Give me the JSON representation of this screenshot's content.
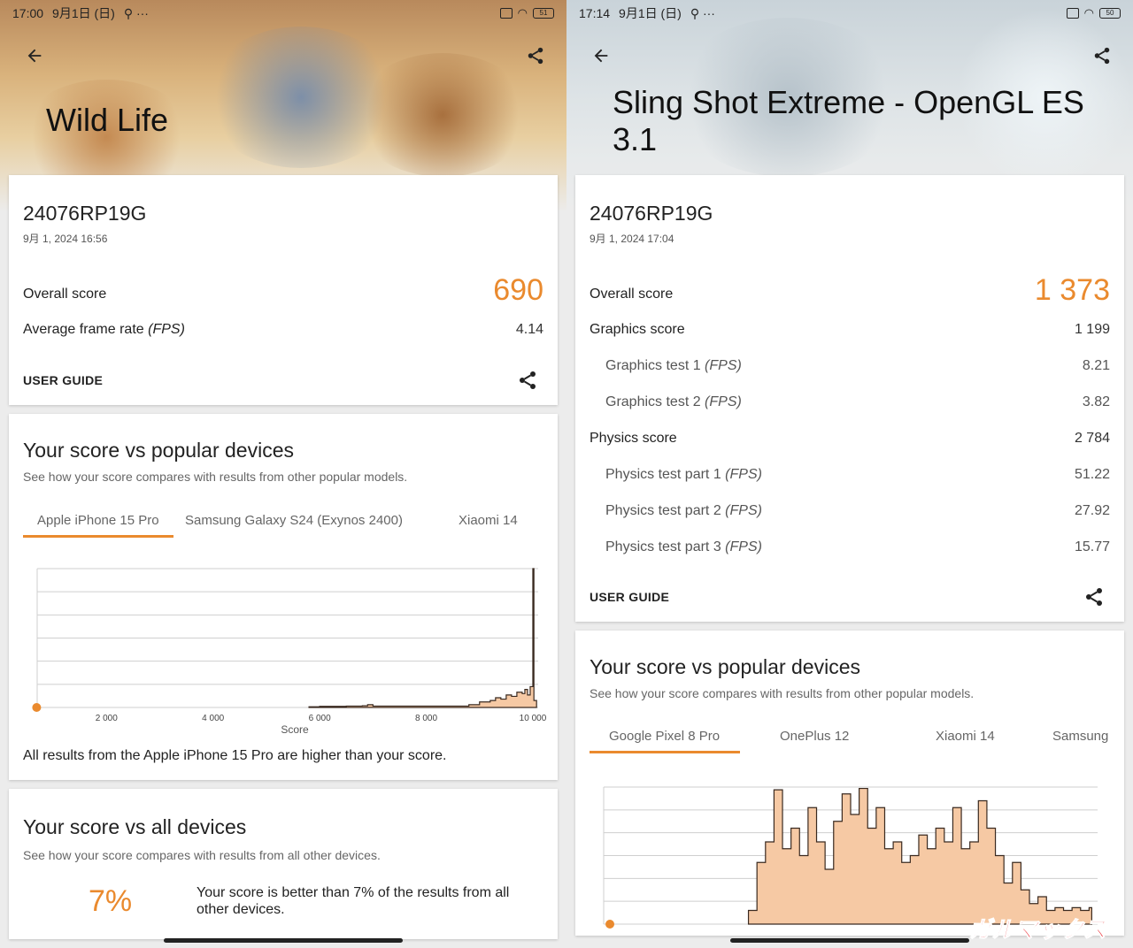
{
  "left": {
    "status": {
      "time": "17:00",
      "date": "9月1日 (日)",
      "battery": "51"
    },
    "title": "Wild Life",
    "device": "24076RP19G",
    "date": "9月 1, 2024 16:56",
    "overall_label": "Overall score",
    "overall_value": "690",
    "fps_label": "Average frame rate",
    "fps_unit": "(FPS)",
    "fps_value": "4.14",
    "user_guide": "USER GUIDE",
    "popular_title": "Your score vs popular devices",
    "popular_sub": "See how your score compares with results from other popular models.",
    "tabs": [
      "Apple iPhone 15 Pro",
      "Samsung Galaxy S24 (Exynos 2400)",
      "Xiaomi 14"
    ],
    "higher_text": "All results from the Apple iPhone 15 Pro are higher than your score.",
    "all_title": "Your score vs all devices",
    "all_sub": "See how your score compares with results from all other devices.",
    "pct": "7%",
    "better_text": "Your score is better than 7% of the results from all other devices."
  },
  "right": {
    "status": {
      "time": "17:14",
      "date": "9月1日 (日)",
      "battery": "50"
    },
    "title": "Sling Shot Extreme - OpenGL ES 3.1",
    "device": "24076RP19G",
    "date": "9月 1, 2024 17:04",
    "overall_label": "Overall score",
    "overall_value": "1 373",
    "rows": [
      {
        "label": "Graphics score",
        "unit": "",
        "value": "1 199",
        "sub": false
      },
      {
        "label": "Graphics test 1",
        "unit": "(FPS)",
        "value": "8.21",
        "sub": true
      },
      {
        "label": "Graphics test 2",
        "unit": "(FPS)",
        "value": "3.82",
        "sub": true
      },
      {
        "label": "Physics score",
        "unit": "",
        "value": "2 784",
        "sub": false
      },
      {
        "label": "Physics test part 1",
        "unit": "(FPS)",
        "value": "51.22",
        "sub": true
      },
      {
        "label": "Physics test part 2",
        "unit": "(FPS)",
        "value": "27.92",
        "sub": true
      },
      {
        "label": "Physics test part 3",
        "unit": "(FPS)",
        "value": "15.77",
        "sub": true
      }
    ],
    "user_guide": "USER GUIDE",
    "popular_title": "Your score vs popular devices",
    "popular_sub": "See how your score compares with results from other popular models.",
    "tabs": [
      "Google Pixel 8 Pro",
      "OnePlus 12",
      "Xiaomi 14",
      "Samsung"
    ]
  },
  "watermark": "ガルマックス",
  "colors": {
    "accent": "#ea8a2e",
    "fill": "#f6c9a4",
    "line": "#3a2a20",
    "grid": "#cfcfcf"
  },
  "chart_data": [
    {
      "type": "area",
      "xlabel": "Score",
      "ticks": [
        "2 000",
        "4 000",
        "6 000",
        "8 000",
        "10 000"
      ],
      "tick_values": [
        2000,
        4000,
        6000,
        8000,
        10000
      ],
      "xlim": [
        700,
        10100
      ],
      "ylim": [
        0,
        1
      ],
      "your_score": 690,
      "x": [
        5800,
        6000,
        6500,
        6800,
        6900,
        7000,
        8800,
        9000,
        9200,
        9300,
        9400,
        9500,
        9600,
        9700,
        9800,
        9850,
        9900,
        9950,
        10000,
        10020
      ],
      "y": [
        0.005,
        0.008,
        0.01,
        0.012,
        0.02,
        0.01,
        0.02,
        0.04,
        0.05,
        0.07,
        0.06,
        0.09,
        0.08,
        0.11,
        0.1,
        0.13,
        0.09,
        0.15,
        1.0,
        0.05
      ],
      "grid": true
    },
    {
      "type": "area",
      "xlabel": "",
      "ticks": [],
      "tick_values": [],
      "xlim": [
        1300,
        7100
      ],
      "ylim": [
        0,
        1
      ],
      "your_score": 1373,
      "x": [
        3000,
        3100,
        3200,
        3300,
        3400,
        3500,
        3600,
        3700,
        3800,
        3900,
        4000,
        4100,
        4200,
        4300,
        4400,
        4500,
        4600,
        4700,
        4800,
        4900,
        5000,
        5100,
        5200,
        5300,
        5400,
        5500,
        5600,
        5700,
        5800,
        5900,
        6000,
        6100,
        6200,
        6300,
        6400,
        6500,
        6600,
        6700,
        6800,
        6900,
        7000
      ],
      "y": [
        0.1,
        0.45,
        0.6,
        0.98,
        0.55,
        0.7,
        0.5,
        0.85,
        0.6,
        0.4,
        0.75,
        0.95,
        0.8,
        0.99,
        0.7,
        0.85,
        0.55,
        0.6,
        0.45,
        0.5,
        0.65,
        0.55,
        0.7,
        0.6,
        0.85,
        0.55,
        0.6,
        0.9,
        0.7,
        0.5,
        0.3,
        0.45,
        0.25,
        0.15,
        0.2,
        0.1,
        0.12,
        0.1,
        0.12,
        0.1,
        0.12
      ],
      "grid": true
    }
  ]
}
